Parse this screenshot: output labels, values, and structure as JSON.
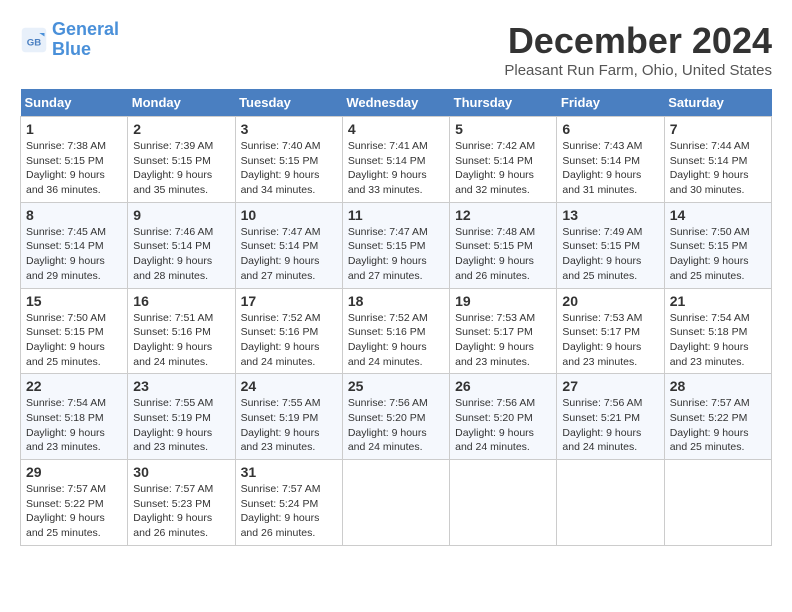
{
  "header": {
    "logo_line1": "General",
    "logo_line2": "Blue",
    "title": "December 2024",
    "location": "Pleasant Run Farm, Ohio, United States"
  },
  "columns": [
    "Sunday",
    "Monday",
    "Tuesday",
    "Wednesday",
    "Thursday",
    "Friday",
    "Saturday"
  ],
  "weeks": [
    [
      {
        "day": "1",
        "info": "Sunrise: 7:38 AM\nSunset: 5:15 PM\nDaylight: 9 hours\nand 36 minutes."
      },
      {
        "day": "2",
        "info": "Sunrise: 7:39 AM\nSunset: 5:15 PM\nDaylight: 9 hours\nand 35 minutes."
      },
      {
        "day": "3",
        "info": "Sunrise: 7:40 AM\nSunset: 5:15 PM\nDaylight: 9 hours\nand 34 minutes."
      },
      {
        "day": "4",
        "info": "Sunrise: 7:41 AM\nSunset: 5:14 PM\nDaylight: 9 hours\nand 33 minutes."
      },
      {
        "day": "5",
        "info": "Sunrise: 7:42 AM\nSunset: 5:14 PM\nDaylight: 9 hours\nand 32 minutes."
      },
      {
        "day": "6",
        "info": "Sunrise: 7:43 AM\nSunset: 5:14 PM\nDaylight: 9 hours\nand 31 minutes."
      },
      {
        "day": "7",
        "info": "Sunrise: 7:44 AM\nSunset: 5:14 PM\nDaylight: 9 hours\nand 30 minutes."
      }
    ],
    [
      {
        "day": "8",
        "info": "Sunrise: 7:45 AM\nSunset: 5:14 PM\nDaylight: 9 hours\nand 29 minutes."
      },
      {
        "day": "9",
        "info": "Sunrise: 7:46 AM\nSunset: 5:14 PM\nDaylight: 9 hours\nand 28 minutes."
      },
      {
        "day": "10",
        "info": "Sunrise: 7:47 AM\nSunset: 5:14 PM\nDaylight: 9 hours\nand 27 minutes."
      },
      {
        "day": "11",
        "info": "Sunrise: 7:47 AM\nSunset: 5:15 PM\nDaylight: 9 hours\nand 27 minutes."
      },
      {
        "day": "12",
        "info": "Sunrise: 7:48 AM\nSunset: 5:15 PM\nDaylight: 9 hours\nand 26 minutes."
      },
      {
        "day": "13",
        "info": "Sunrise: 7:49 AM\nSunset: 5:15 PM\nDaylight: 9 hours\nand 25 minutes."
      },
      {
        "day": "14",
        "info": "Sunrise: 7:50 AM\nSunset: 5:15 PM\nDaylight: 9 hours\nand 25 minutes."
      }
    ],
    [
      {
        "day": "15",
        "info": "Sunrise: 7:50 AM\nSunset: 5:15 PM\nDaylight: 9 hours\nand 25 minutes."
      },
      {
        "day": "16",
        "info": "Sunrise: 7:51 AM\nSunset: 5:16 PM\nDaylight: 9 hours\nand 24 minutes."
      },
      {
        "day": "17",
        "info": "Sunrise: 7:52 AM\nSunset: 5:16 PM\nDaylight: 9 hours\nand 24 minutes."
      },
      {
        "day": "18",
        "info": "Sunrise: 7:52 AM\nSunset: 5:16 PM\nDaylight: 9 hours\nand 24 minutes."
      },
      {
        "day": "19",
        "info": "Sunrise: 7:53 AM\nSunset: 5:17 PM\nDaylight: 9 hours\nand 23 minutes."
      },
      {
        "day": "20",
        "info": "Sunrise: 7:53 AM\nSunset: 5:17 PM\nDaylight: 9 hours\nand 23 minutes."
      },
      {
        "day": "21",
        "info": "Sunrise: 7:54 AM\nSunset: 5:18 PM\nDaylight: 9 hours\nand 23 minutes."
      }
    ],
    [
      {
        "day": "22",
        "info": "Sunrise: 7:54 AM\nSunset: 5:18 PM\nDaylight: 9 hours\nand 23 minutes."
      },
      {
        "day": "23",
        "info": "Sunrise: 7:55 AM\nSunset: 5:19 PM\nDaylight: 9 hours\nand 23 minutes."
      },
      {
        "day": "24",
        "info": "Sunrise: 7:55 AM\nSunset: 5:19 PM\nDaylight: 9 hours\nand 23 minutes."
      },
      {
        "day": "25",
        "info": "Sunrise: 7:56 AM\nSunset: 5:20 PM\nDaylight: 9 hours\nand 24 minutes."
      },
      {
        "day": "26",
        "info": "Sunrise: 7:56 AM\nSunset: 5:20 PM\nDaylight: 9 hours\nand 24 minutes."
      },
      {
        "day": "27",
        "info": "Sunrise: 7:56 AM\nSunset: 5:21 PM\nDaylight: 9 hours\nand 24 minutes."
      },
      {
        "day": "28",
        "info": "Sunrise: 7:57 AM\nSunset: 5:22 PM\nDaylight: 9 hours\nand 25 minutes."
      }
    ],
    [
      {
        "day": "29",
        "info": "Sunrise: 7:57 AM\nSunset: 5:22 PM\nDaylight: 9 hours\nand 25 minutes."
      },
      {
        "day": "30",
        "info": "Sunrise: 7:57 AM\nSunset: 5:23 PM\nDaylight: 9 hours\nand 26 minutes."
      },
      {
        "day": "31",
        "info": "Sunrise: 7:57 AM\nSunset: 5:24 PM\nDaylight: 9 hours\nand 26 minutes."
      },
      {
        "day": "",
        "info": ""
      },
      {
        "day": "",
        "info": ""
      },
      {
        "day": "",
        "info": ""
      },
      {
        "day": "",
        "info": ""
      }
    ]
  ]
}
